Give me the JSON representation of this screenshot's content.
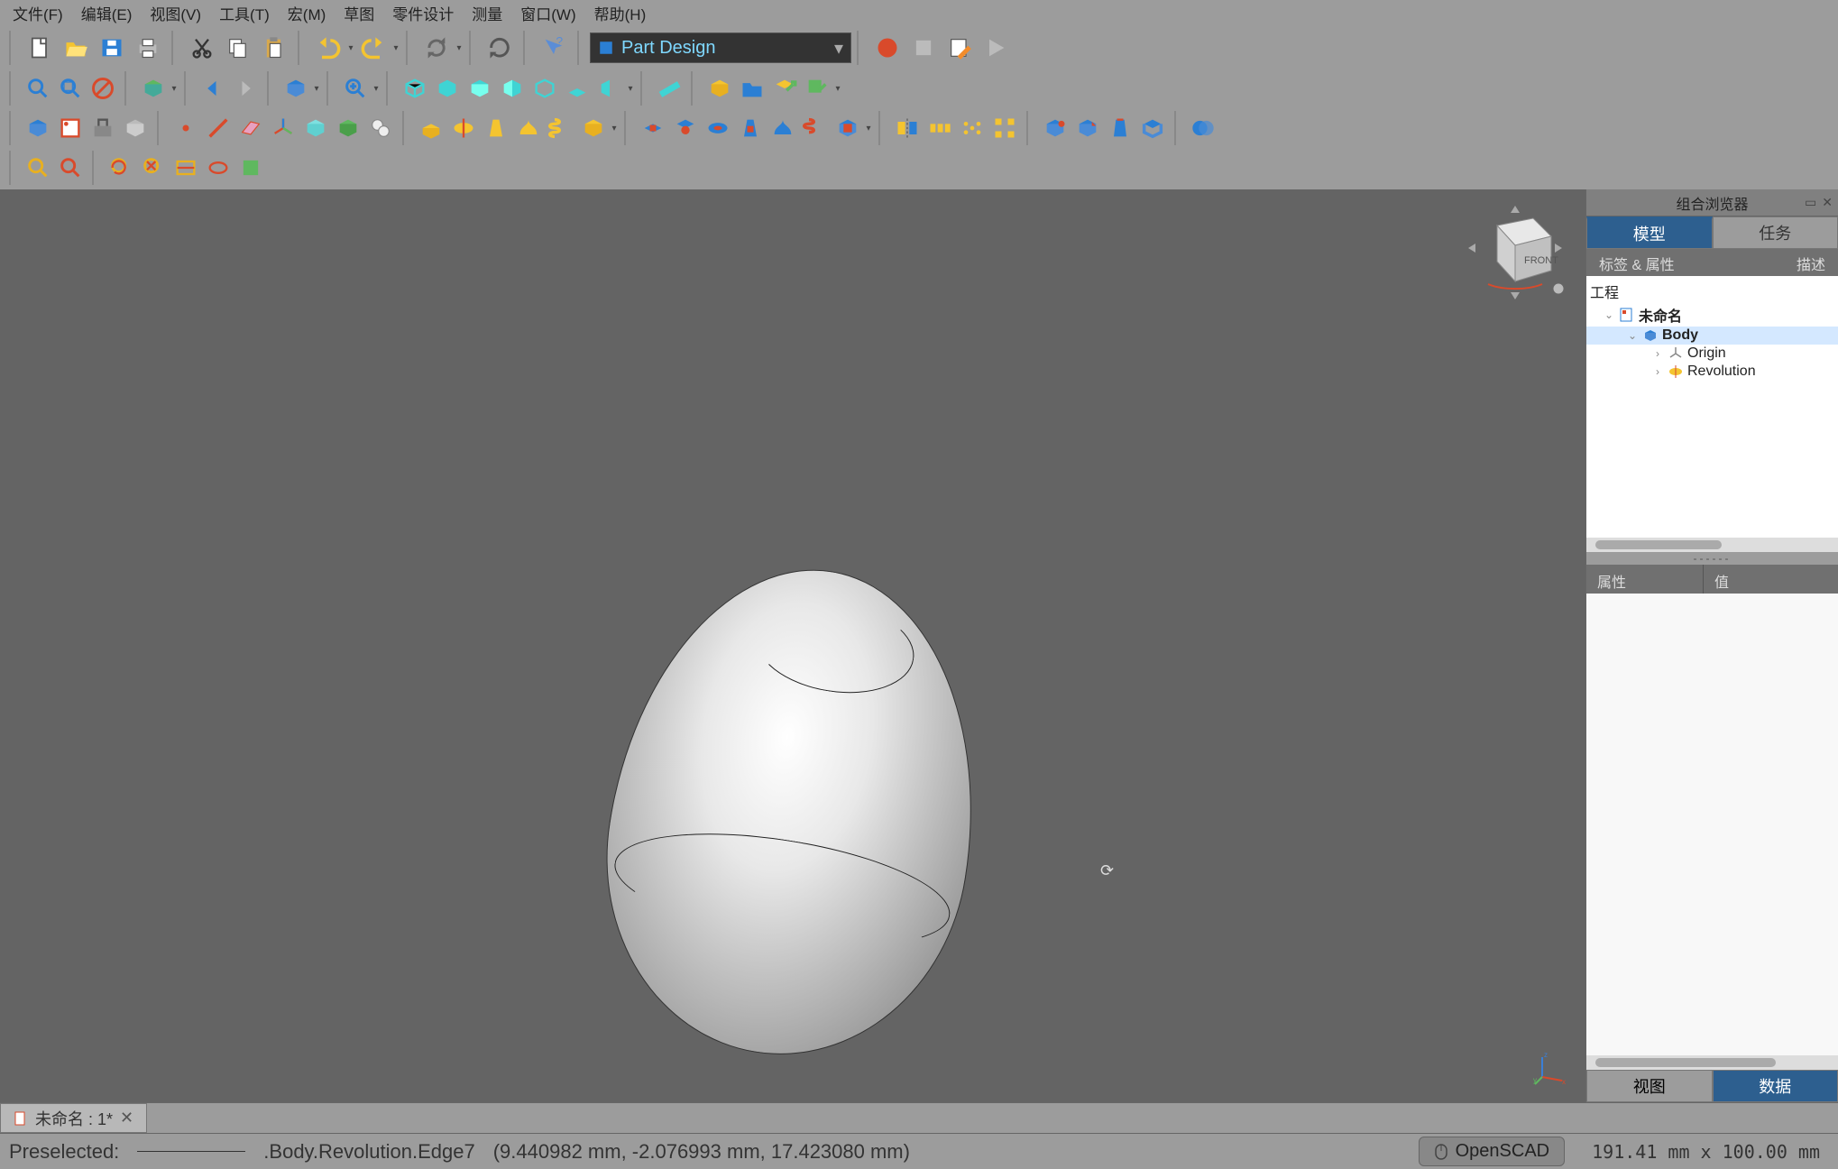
{
  "menu": {
    "file": "文件(F)",
    "edit": "编辑(E)",
    "view": "视图(V)",
    "tools": "工具(T)",
    "macro": "宏(M)",
    "sketch": "草图",
    "partdesign": "零件设计",
    "measure": "测量",
    "window": "窗口(W)",
    "help": "帮助(H)"
  },
  "workbench": {
    "selected": "Part Design"
  },
  "combo": {
    "title": "组合浏览器",
    "tabs": {
      "model": "模型",
      "tasks": "任务"
    },
    "subtabs": {
      "labels": "标签 & 属性",
      "desc": "描述"
    },
    "propTabs": {
      "view": "视图",
      "data": "数据"
    },
    "propHeader": {
      "prop": "属性",
      "value": "值"
    }
  },
  "tree": {
    "root": "工程",
    "doc": "未命名",
    "body": "Body",
    "origin": "Origin",
    "revolution": "Revolution"
  },
  "splitter": "------",
  "doctab": {
    "label": "未命名 : 1*"
  },
  "status": {
    "preselected_label": "Preselected:",
    "preselected_path": ".Body.Revolution.Edge7",
    "coords": "(9.440982 mm, -2.076993 mm, 17.423080 mm)",
    "renderer": "OpenSCAD",
    "dims": "191.41 mm x 100.00 mm"
  },
  "navcube": {
    "face": "FRONT"
  },
  "axes": {
    "x": "x",
    "y": "y",
    "z": "z"
  }
}
